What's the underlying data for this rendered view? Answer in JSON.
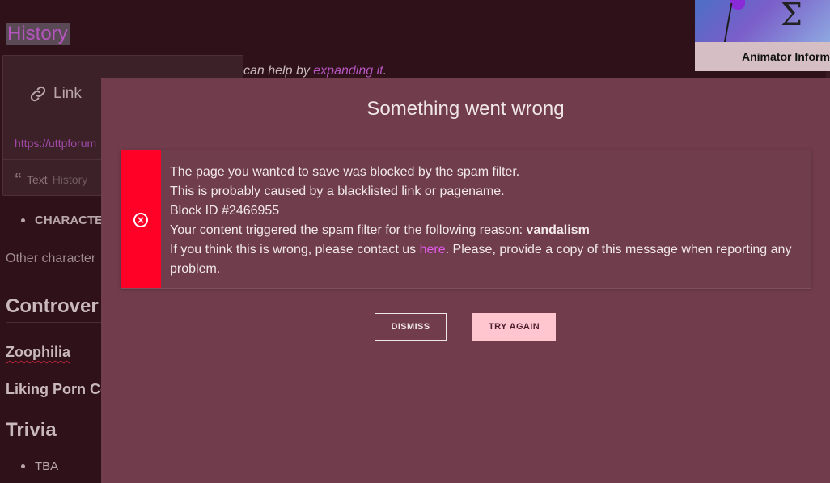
{
  "article": {
    "history_heading": "History",
    "intro_prefix": "can help by ",
    "intro_link": "expanding it",
    "intro_suffix": ".",
    "link_popup": {
      "title": "Link",
      "url": "https://uttpforum",
      "footer_text_label": "Text",
      "footer_value": "History"
    },
    "characters_bullet": "CHARACTE",
    "other_characters": "Other character",
    "controversy_heading": "Controver",
    "zoophilia": "Zoophilia",
    "liking_porn": "Liking Porn Co",
    "trivia_heading": "Trivia",
    "tba": "TBA"
  },
  "infobox": {
    "label": "Animator Inform"
  },
  "modal": {
    "title": "Something went wrong",
    "line1": "The page you wanted to save was blocked by the spam filter.",
    "line2": "This is probably caused by a blacklisted link or pagename.",
    "line3": "Block ID #2466955",
    "line4_prefix": "Your content triggered the spam filter for the following reason: ",
    "line4_reason": "vandalism",
    "line5_prefix": "If you think this is wrong, please contact us ",
    "line5_link": "here",
    "line5_suffix": ". Please, provide a copy of this message when reporting any problem.",
    "dismiss_label": "DISMISS",
    "try_again_label": "TRY AGAIN",
    "colors": {
      "alert_side": "#ff0026",
      "modal_bg": "#713d4d",
      "link": "#e05ae8",
      "try_again_bg": "#ffc6d0"
    }
  }
}
